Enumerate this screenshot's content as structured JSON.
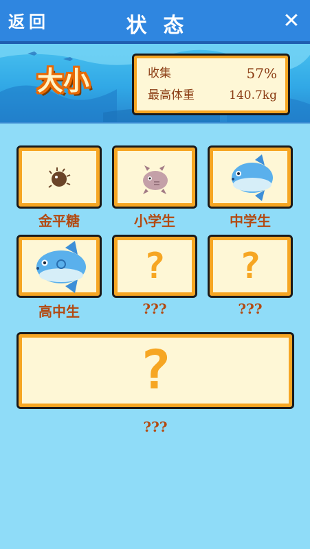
{
  "header": {
    "back_label": "返回",
    "title": "状态",
    "close_label": "✕"
  },
  "banner": {
    "category": "大小",
    "collect_label": "收集",
    "collect_value": "57%",
    "max_weight_label": "最高体重",
    "max_weight_value": "140.7kg"
  },
  "stages": [
    {
      "name": "金平糖",
      "unlocked": true,
      "icon": "tiny-sunfish-icon"
    },
    {
      "name": "小学生",
      "unlocked": true,
      "icon": "small-sunfish-icon"
    },
    {
      "name": "中学生",
      "unlocked": true,
      "icon": "middle-sunfish-icon"
    },
    {
      "name": "高中生",
      "unlocked": true,
      "icon": "high-school-sunfish-icon"
    },
    {
      "name": "???",
      "unlocked": false,
      "icon": "question-mark-icon"
    },
    {
      "name": "???",
      "unlocked": false,
      "icon": "question-mark-icon"
    },
    {
      "name": "???",
      "unlocked": false,
      "icon": "question-mark-icon"
    }
  ],
  "locked_symbol": "?",
  "colors": {
    "background": "#8fdcf8",
    "top_bar": "#2f86e0",
    "card_fill": "#fef7d6",
    "card_border": "#f6a623",
    "label_text": "#b34a12"
  }
}
